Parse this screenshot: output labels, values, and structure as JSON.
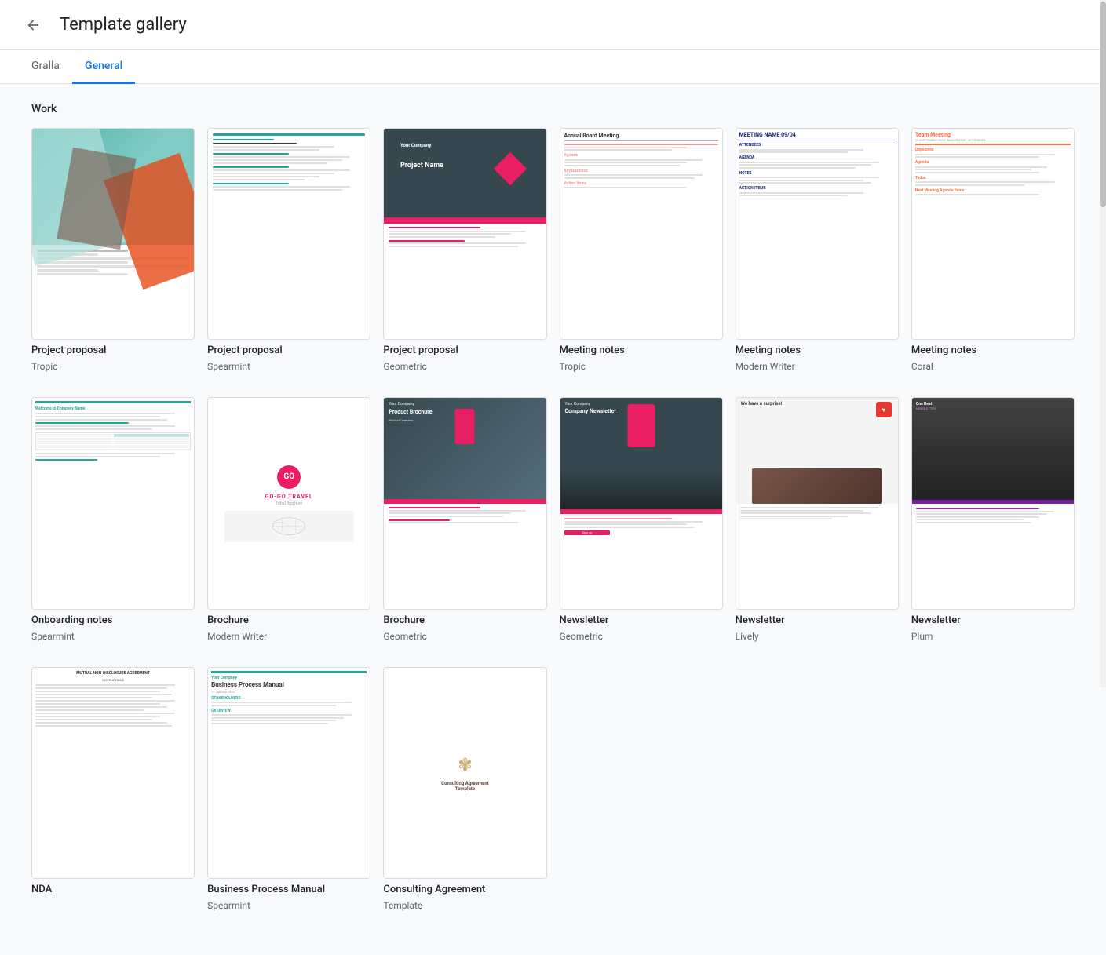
{
  "header": {
    "title": "Template gallery",
    "back_label": "Back"
  },
  "tabs": [
    {
      "id": "gralla",
      "label": "Gralla",
      "active": false
    },
    {
      "id": "general",
      "label": "General",
      "active": true
    }
  ],
  "sections": [
    {
      "id": "work",
      "title": "Work",
      "templates": [
        {
          "id": 1,
          "name": "Project proposal",
          "sub": "Tropic",
          "type": "project-proposal-tropic"
        },
        {
          "id": 2,
          "name": "Project proposal",
          "sub": "Spearmint",
          "type": "project-proposal-spearmint"
        },
        {
          "id": 3,
          "name": "Project proposal",
          "sub": "Geometric",
          "type": "project-proposal-geo"
        },
        {
          "id": 4,
          "name": "Meeting notes",
          "sub": "Tropic",
          "type": "meeting-notes-tropic"
        },
        {
          "id": 5,
          "name": "Meeting notes",
          "sub": "Modern Writer",
          "type": "meeting-notes-mw"
        },
        {
          "id": 6,
          "name": "Meeting notes",
          "sub": "Coral",
          "type": "meeting-notes-coral"
        },
        {
          "id": 7,
          "name": "Onboarding notes",
          "sub": "Spearmint",
          "type": "onboarding-spearmint"
        },
        {
          "id": 8,
          "name": "Brochure",
          "sub": "Modern Writer",
          "type": "brochure-mw"
        },
        {
          "id": 9,
          "name": "Brochure",
          "sub": "Geometric",
          "type": "brochure-geo"
        },
        {
          "id": 10,
          "name": "Newsletter",
          "sub": "Geometric",
          "type": "newsletter-geo"
        },
        {
          "id": 11,
          "name": "Newsletter",
          "sub": "Lively",
          "type": "newsletter-lively"
        },
        {
          "id": 12,
          "name": "Newsletter",
          "sub": "Plum",
          "type": "newsletter-plum"
        },
        {
          "id": 13,
          "name": "NDA",
          "sub": "",
          "type": "nda"
        },
        {
          "id": 14,
          "name": "Business Process Manual",
          "sub": "Spearmint",
          "type": "bpm"
        },
        {
          "id": 15,
          "name": "Consulting Agreement",
          "sub": "Template",
          "type": "consulting"
        }
      ]
    }
  ]
}
